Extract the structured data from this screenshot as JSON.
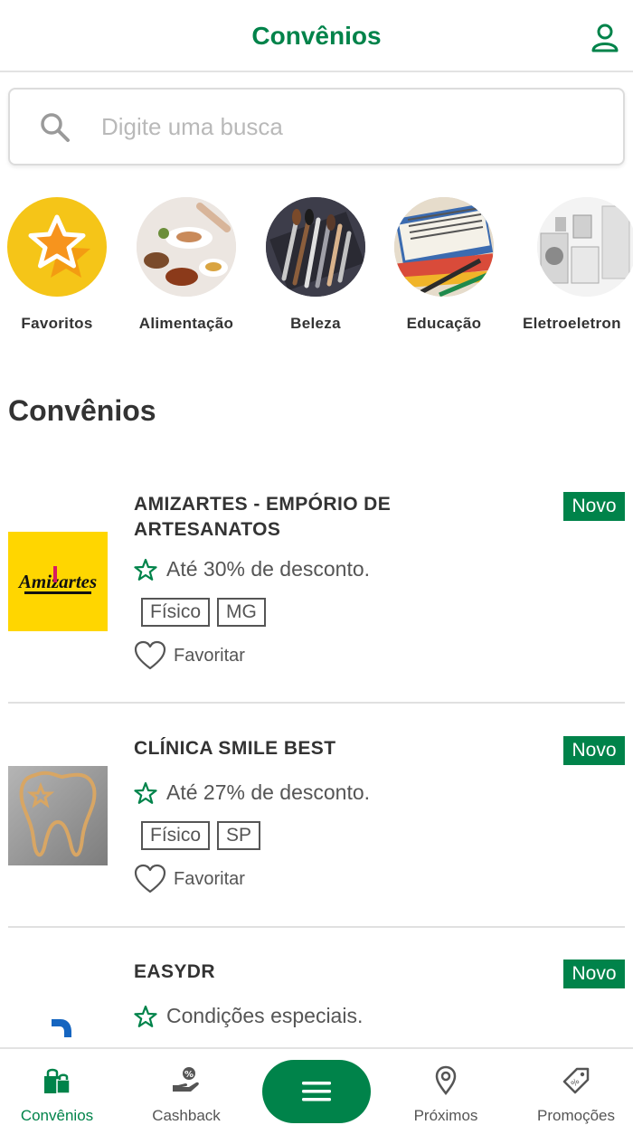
{
  "header": {
    "title": "Convênios",
    "user_icon": "user-icon"
  },
  "search": {
    "placeholder": "Digite uma busca",
    "icon": "search-icon"
  },
  "categories": [
    {
      "label": "Favoritos"
    },
    {
      "label": "Alimentação"
    },
    {
      "label": "Beleza"
    },
    {
      "label": "Educação"
    },
    {
      "label": "Eletroeletron"
    }
  ],
  "section": {
    "title": "Convênios"
  },
  "cards": [
    {
      "name": "AMIZARTES - EMPÓRIO DE ARTESANATOS",
      "logo_text": "Amizartes",
      "badge": "Novo",
      "discount": "Até 30% de desconto.",
      "tags": [
        "Físico",
        "MG"
      ],
      "favorite_label": "Favoritar"
    },
    {
      "name": "CLÍNICA SMILE BEST",
      "badge": "Novo",
      "discount": "Até 27% de desconto.",
      "tags": [
        "Físico",
        "SP"
      ],
      "favorite_label": "Favoritar"
    },
    {
      "name": "EASYDR",
      "badge": "Novo",
      "discount": "Condições especiais."
    }
  ],
  "bottom_nav": {
    "items": [
      {
        "label": "Convênios",
        "icon": "shopping-bags-icon",
        "active": true
      },
      {
        "label": "Cashback",
        "icon": "hand-coin-icon",
        "active": false
      },
      {
        "label": "Próximos",
        "icon": "location-pin-icon",
        "active": false
      },
      {
        "label": "Promoções",
        "icon": "price-tag-icon",
        "active": false
      }
    ],
    "menu_icon": "menu-icon"
  },
  "colors": {
    "brand": "#00834a",
    "favorites_yellow": "#f5c518",
    "logo_yellow": "#ffd600"
  }
}
